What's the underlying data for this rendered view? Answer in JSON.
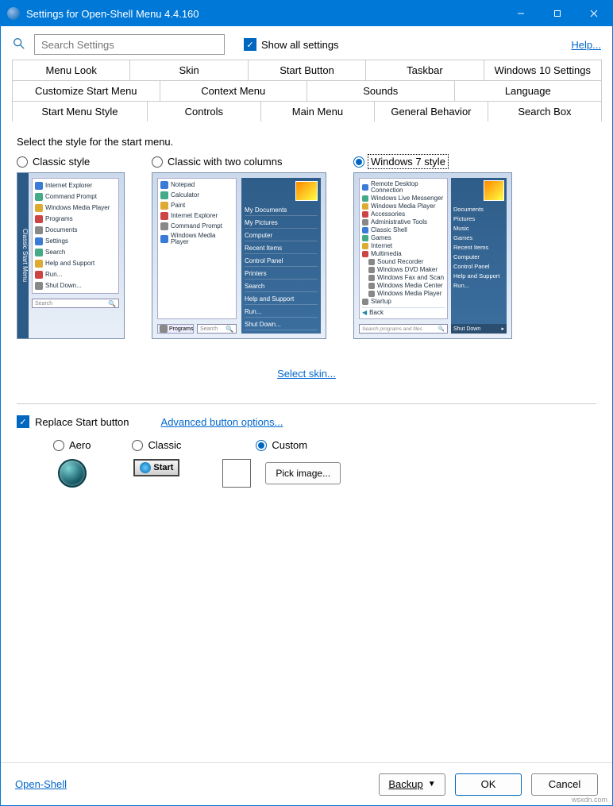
{
  "title": "Settings for Open-Shell Menu 4.4.160",
  "search_placeholder": "Search Settings",
  "show_all": "Show all settings",
  "help": "Help...",
  "tabs": {
    "row1": [
      "Menu Look",
      "Skin",
      "Start Button",
      "Taskbar",
      "Windows 10 Settings"
    ],
    "row2": [
      "Customize Start Menu",
      "Context Menu",
      "Sounds",
      "Language"
    ],
    "row3": [
      "Start Menu Style",
      "Controls",
      "Main Menu",
      "General Behavior",
      "Search Box"
    ]
  },
  "section_label": "Select the style for the start menu.",
  "styles": {
    "classic": {
      "label": "Classic style",
      "side": "Classic Start Menu",
      "items": [
        "Internet Explorer",
        "Command Prompt",
        "Windows Media Player",
        "Programs",
        "Documents",
        "Settings",
        "Search",
        "Help and Support",
        "Run...",
        "Shut Down..."
      ],
      "search": "Search"
    },
    "two_col": {
      "label": "Classic with two columns",
      "left": [
        "Notepad",
        "Calculator",
        "Paint",
        "Internet Explorer",
        "Command Prompt",
        "Windows Media Player"
      ],
      "programs": "Programs",
      "right": [
        "My Documents",
        "My Pictures",
        "Computer",
        "Recent Items",
        "Control Panel",
        "Printers",
        "Search",
        "Help and Support",
        "Run...",
        "Shut Down..."
      ],
      "search": "Search"
    },
    "win7": {
      "label": "Windows 7 style",
      "left": [
        "Remote Desktop Connection",
        "Windows Live Messenger",
        "Windows Media Player",
        "Accessories",
        "Administrative Tools",
        "Classic Shell",
        "Games",
        "Internet",
        "Multimedia",
        "  Sound Recorder",
        "  Windows DVD Maker",
        "  Windows Fax and Scan",
        "  Windows Media Center",
        "  Windows Media Player",
        "Startup"
      ],
      "back": "Back",
      "right": [
        "Documents",
        "Pictures",
        "Music",
        "Games",
        "Recent Items",
        "Computer",
        "Control Panel",
        "Help and Support",
        "Run..."
      ],
      "search": "Search programs and files",
      "shutdown": "Shut Down"
    }
  },
  "select_skin": "Select skin...",
  "replace_label": "Replace Start button",
  "advanced_btn": "Advanced button options...",
  "btn_styles": {
    "aero": "Aero",
    "classic": "Classic",
    "classic_btn": "Start",
    "custom": "Custom",
    "pick": "Pick image..."
  },
  "footer": {
    "link": "Open-Shell",
    "backup": "Backup",
    "ok": "OK",
    "cancel": "Cancel"
  },
  "watermark": "wsxdn.com"
}
